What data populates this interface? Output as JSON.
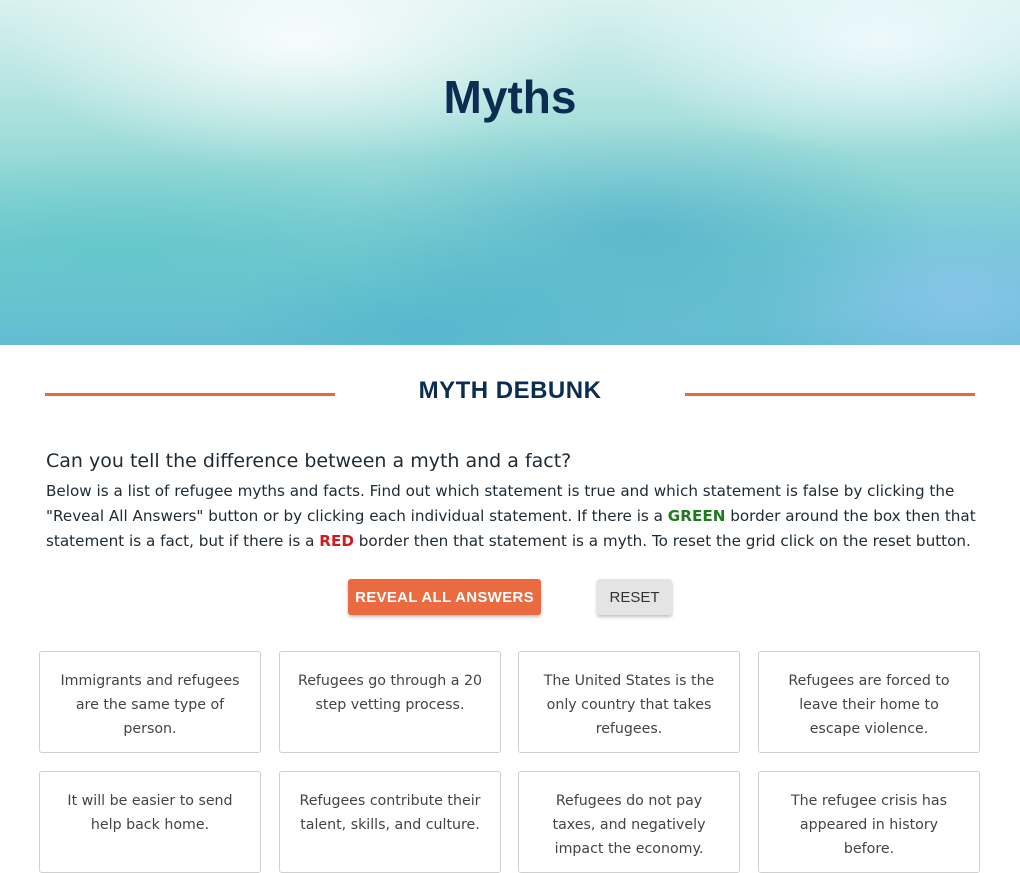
{
  "hero": {
    "title": "Myths"
  },
  "section": {
    "title": "MYTH DEBUNK",
    "accent_color": "#e8693f"
  },
  "intro": {
    "question": "Can you tell the difference between a myth and a fact?",
    "text_1": "Below is a list of refugee myths and facts. Find out which statement is true and which statement is false by clicking the \"Reveal All Answers\" button or by clicking each individual statement. If there is a ",
    "green_word": "GREEN",
    "text_2": " border around the box then that statement is a fact, but if there is a ",
    "red_word": "RED",
    "text_3": " border then that statement is a myth. To reset the grid click on the reset button."
  },
  "buttons": {
    "reveal_label": "REVEAL ALL ANSWERS",
    "reset_label": "RESET",
    "reveal_color": "#ec6a40"
  },
  "statements": [
    "Immigrants and refugees are the same type of person.",
    "Refugees go through a 20 step vetting process.",
    "The United States is the only country that takes refugees.",
    "Refugees are forced to leave their home to escape violence.",
    "It will be easier to send help back home.",
    "Refugees contribute their talent, skills, and culture.",
    "Refugees do not pay taxes, and negatively impact the economy.",
    "The refugee crisis has appeared in history before."
  ]
}
